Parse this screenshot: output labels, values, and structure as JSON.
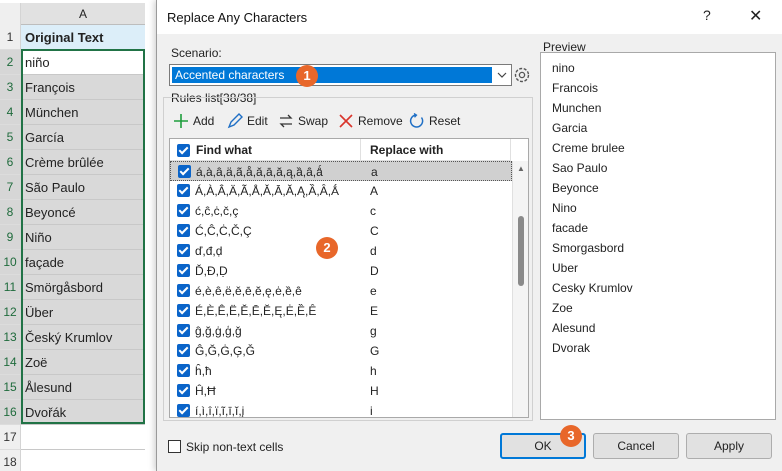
{
  "sheet": {
    "column_header": "A",
    "row_numbers": [
      "1",
      "2",
      "3",
      "4",
      "5",
      "6",
      "7",
      "8",
      "9",
      "10",
      "11",
      "12",
      "13",
      "14",
      "15",
      "16",
      "17",
      "18"
    ],
    "cells": [
      "Original Text",
      "niño",
      "François",
      "München",
      "García",
      "Crème brûlée",
      "São Paulo",
      "Beyoncé",
      "Niño",
      "façade",
      "Smörgåsbord",
      "Über",
      "Český Krumlov",
      "Zoë",
      "Ålesund",
      "Dvořák"
    ]
  },
  "dialog": {
    "title": "Replace Any Characters",
    "help_label": "?",
    "close_label": "✕",
    "scenario_label": "Scenario:",
    "scenario_value": "Accented characters",
    "rules_label": "Rules list[38/38]",
    "toolbar": {
      "add": "Add",
      "edit": "Edit",
      "swap": "Swap",
      "remove": "Remove",
      "reset": "Reset"
    },
    "table_headers": {
      "find": "Find what",
      "replace": "Replace with"
    },
    "rules": [
      {
        "find": "á,à,â,ä,ã,å,ǎ,ā,ă,ą,ȁ,ȃ,ǻ",
        "replace": "a"
      },
      {
        "find": "Á,À,Â,Ä,Ã,Å,Ǎ,Ā,Ă,Ą,Ȁ,Ȃ,Ǻ",
        "replace": "A"
      },
      {
        "find": "ć,ĉ,ċ,č,ç",
        "replace": "c"
      },
      {
        "find": "Ć,Ĉ,Ċ,Č,Ç",
        "replace": "C"
      },
      {
        "find": "ď,đ,ḍ",
        "replace": "d"
      },
      {
        "find": "Ď,Đ,Ḍ",
        "replace": "D"
      },
      {
        "find": "é,è,ê,ë,ě,ē,ĕ,ę,ė,ȅ,ȇ",
        "replace": "e"
      },
      {
        "find": "É,È,Ê,Ë,Ě,Ē,Ĕ,Ę,Ė,Ȅ,Ȇ",
        "replace": "E"
      },
      {
        "find": "ĝ,ğ,ġ,ģ,ǧ",
        "replace": "g"
      },
      {
        "find": "Ĝ,Ğ,Ġ,Ģ,Ǧ",
        "replace": "G"
      },
      {
        "find": "ĥ,ħ",
        "replace": "h"
      },
      {
        "find": "Ĥ,Ħ",
        "replace": "H"
      },
      {
        "find": "í,ì,î,ï,ĩ,ī,ĭ,į",
        "replace": "i"
      }
    ],
    "preview_label": "Preview",
    "preview_items": [
      "nino",
      "Francois",
      "Munchen",
      "Garcia",
      "Creme brulee",
      "Sao Paulo",
      "Beyonce",
      "Nino",
      "facade",
      "Smorgasbord",
      "Uber",
      "Cesky Krumlov",
      "Zoe",
      "Alesund",
      "Dvorak"
    ],
    "skip_label": "Skip non-text cells",
    "ok_label": "OK",
    "cancel_label": "Cancel",
    "apply_label": "Apply",
    "badges": [
      "1",
      "2",
      "3"
    ]
  },
  "colors": {
    "accent": "#0078d7",
    "badge": "#e8672a",
    "excel_green": "#217346"
  }
}
